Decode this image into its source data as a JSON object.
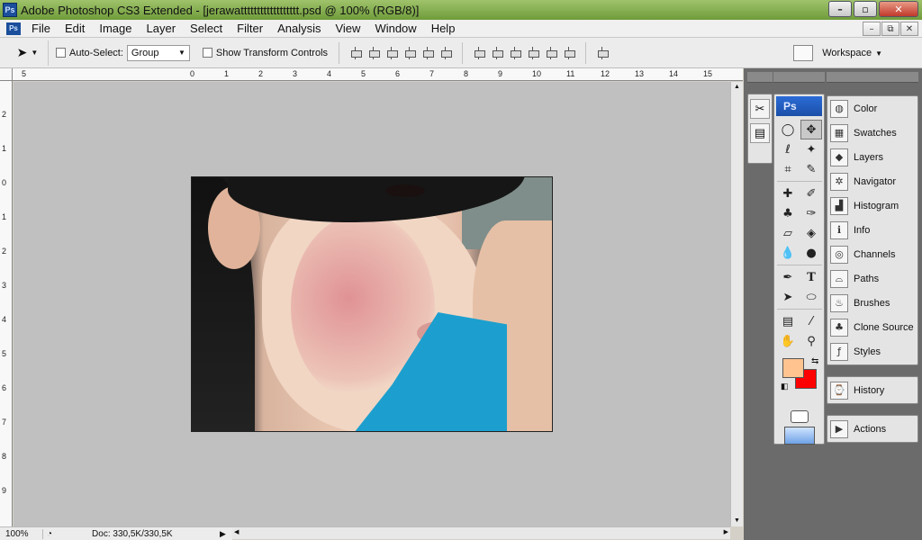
{
  "app": {
    "badge": "Ps",
    "window_title": "Adobe Photoshop CS3 Extended - [jerawatttttttttttttttttt.psd @ 100% (RGB/8)]",
    "min": "–",
    "max": "▫",
    "close": "✕"
  },
  "menu": {
    "items": [
      "File",
      "Edit",
      "Image",
      "Layer",
      "Select",
      "Filter",
      "Analysis",
      "View",
      "Window",
      "Help"
    ],
    "doc_min": "–",
    "doc_restore": "⧉",
    "doc_close": "✕"
  },
  "options": {
    "auto_select_label": "Auto-Select:",
    "auto_select_value": "Group",
    "show_transform_label": "Show Transform Controls",
    "workspace_label": "Workspace"
  },
  "ruler": {
    "top": [
      "5",
      "0",
      "1",
      "2",
      "3",
      "4",
      "5",
      "6",
      "7",
      "8",
      "9",
      "10",
      "11",
      "12",
      "13",
      "14",
      "15"
    ],
    "left": [
      "2",
      "1",
      "0",
      "1",
      "2",
      "3",
      "4",
      "5",
      "6",
      "7",
      "8",
      "9"
    ]
  },
  "status": {
    "zoom": "100%",
    "doc": "Doc: 330,5K/330,5K"
  },
  "toolbox": {
    "banner": "Ps",
    "tools": [
      {
        "name": "marquee-tool-icon",
        "glyph": "◯"
      },
      {
        "name": "move-tool-icon",
        "glyph": "✥"
      },
      {
        "name": "lasso-tool-icon",
        "glyph": "ℓ"
      },
      {
        "name": "magic-wand-tool-icon",
        "glyph": "✦"
      },
      {
        "name": "crop-tool-icon",
        "glyph": "⌗"
      },
      {
        "name": "slice-tool-icon",
        "glyph": "✎"
      },
      {
        "name": "healing-brush-tool-icon",
        "glyph": "✚"
      },
      {
        "name": "brush-tool-icon",
        "glyph": "✐"
      },
      {
        "name": "clone-stamp-tool-icon",
        "glyph": "♣"
      },
      {
        "name": "history-brush-tool-icon",
        "glyph": "✑"
      },
      {
        "name": "eraser-tool-icon",
        "glyph": "▱"
      },
      {
        "name": "paint-bucket-tool-icon",
        "glyph": "◈"
      },
      {
        "name": "blur-tool-icon",
        "glyph": "💧"
      },
      {
        "name": "dodge-tool-icon",
        "glyph": "●"
      },
      {
        "name": "pen-tool-icon",
        "glyph": "✒"
      },
      {
        "name": "type-tool-icon",
        "glyph": "T"
      },
      {
        "name": "path-selection-tool-icon",
        "glyph": "➤"
      },
      {
        "name": "shape-tool-icon",
        "glyph": "⬭"
      },
      {
        "name": "notes-tool-icon",
        "glyph": "▤"
      },
      {
        "name": "eyedropper-tool-icon",
        "glyph": "⁄"
      },
      {
        "name": "hand-tool-icon",
        "glyph": "✋"
      },
      {
        "name": "zoom-tool-icon",
        "glyph": "⚲"
      }
    ],
    "foreground_color": "#ffc38f",
    "background_color": "#ff0000"
  },
  "panels": {
    "group1": [
      {
        "label": "Color",
        "icon": "color-panel-icon",
        "glyph": "◍"
      },
      {
        "label": "Swatches",
        "icon": "swatches-panel-icon",
        "glyph": "▦"
      },
      {
        "label": "Layers",
        "icon": "layers-panel-icon",
        "glyph": "◆"
      },
      {
        "label": "Navigator",
        "icon": "navigator-panel-icon",
        "glyph": "✲"
      },
      {
        "label": "Histogram",
        "icon": "histogram-panel-icon",
        "glyph": "▟"
      },
      {
        "label": "Info",
        "icon": "info-panel-icon",
        "glyph": "ℹ"
      },
      {
        "label": "Channels",
        "icon": "channels-panel-icon",
        "glyph": "◎"
      },
      {
        "label": "Paths",
        "icon": "paths-panel-icon",
        "glyph": "⌓"
      },
      {
        "label": "Brushes",
        "icon": "brushes-panel-icon",
        "glyph": "♨"
      },
      {
        "label": "Clone Source",
        "icon": "clone-source-panel-icon",
        "glyph": "♣"
      },
      {
        "label": "Styles",
        "icon": "styles-panel-icon",
        "glyph": "ƒ"
      }
    ],
    "group2": [
      {
        "label": "History",
        "icon": "history-panel-icon",
        "glyph": "⌚"
      }
    ],
    "group3": [
      {
        "label": "Actions",
        "icon": "actions-panel-icon",
        "glyph": "▶"
      }
    ]
  }
}
